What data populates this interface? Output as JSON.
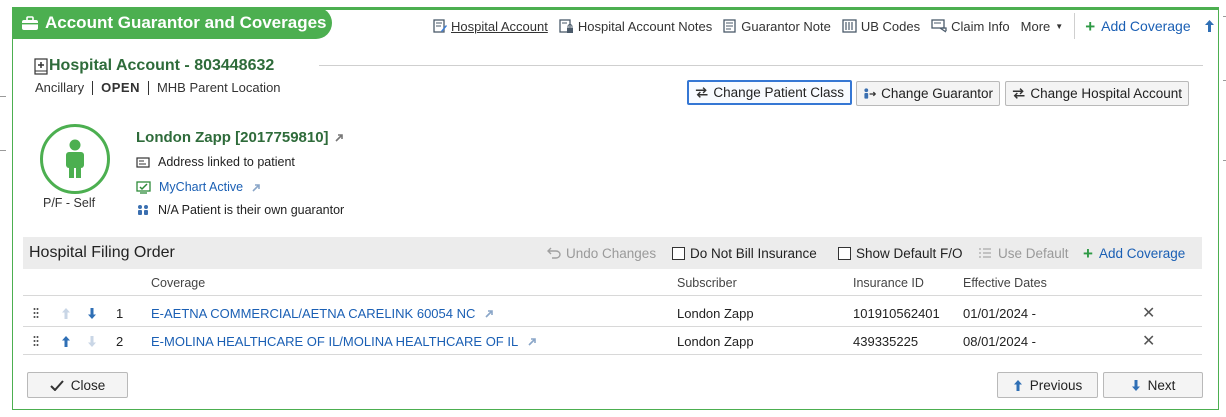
{
  "title": "Account Guarantor and Coverages",
  "toolbar": {
    "hospital_account": "Hospital Account",
    "hospital_account_notes": "Hospital Account Notes",
    "guarantor_note": "Guarantor Note",
    "ub_codes": "UB Codes",
    "claim_info": "Claim Info",
    "more": "More",
    "add_coverage": "Add Coverage"
  },
  "hospital_account": {
    "title": "Hospital Account - 803448632",
    "type": "Ancillary",
    "status": "OPEN",
    "location": "MHB Parent Location"
  },
  "actions": {
    "change_patient_class": "Change Patient Class",
    "change_guarantor": "Change Guarantor",
    "change_hospital_account": "Change Hospital Account"
  },
  "guarantor": {
    "name": "London Zapp [2017759810]",
    "relationship": "P/F - Self",
    "address": "Address linked to patient",
    "mychart": "MyChart Active",
    "note": "N/A Patient is their own guarantor"
  },
  "filing": {
    "title": "Hospital Filing Order",
    "undo": "Undo Changes",
    "do_not_bill": "Do Not Bill Insurance",
    "show_default": "Show Default F/O",
    "use_default": "Use Default",
    "add_coverage": "Add Coverage"
  },
  "table": {
    "headers": [
      "Coverage",
      "Subscriber",
      "Insurance ID",
      "Effective Dates"
    ],
    "rows": [
      {
        "num": "1",
        "coverage": "E-AETNA COMMERCIAL/AETNA CARELINK 60054 NC",
        "subscriber": "London Zapp",
        "insurance_id": "101910562401",
        "effective": "01/01/2024 -"
      },
      {
        "num": "2",
        "coverage": "E-MOLINA HEALTHCARE OF IL/MOLINA HEALTHCARE OF IL",
        "subscriber": "London Zapp",
        "insurance_id": "439335225",
        "effective": "08/01/2024 -"
      }
    ]
  },
  "footer": {
    "close": "Close",
    "previous": "Previous",
    "next": "Next"
  },
  "colors": {
    "brand_green": "#4caf50",
    "link_blue": "#1a5fb4",
    "heading_green": "#2e6b3a"
  }
}
